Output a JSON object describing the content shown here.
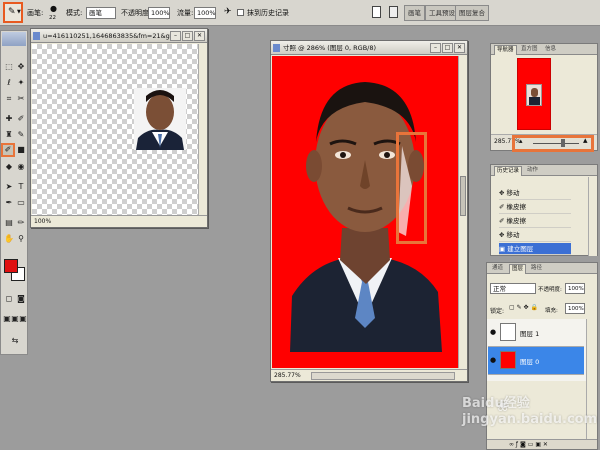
{
  "options_bar": {
    "brush_label": "画笔:",
    "brush_size": "22",
    "mode_label": "模式:",
    "mode_value": "画笔",
    "opacity_label": "不透明度:",
    "opacity_value": "100%",
    "flow_label": "流量:",
    "flow_value": "100%",
    "erase_history_label": "抹到历史记录",
    "tabs": [
      "画笔",
      "工具预设",
      "图层复合"
    ]
  },
  "small_window": {
    "title": "u=416110251,1646863835&fm=21&g...",
    "zoom": "100%"
  },
  "main_window": {
    "title": "寸照 @ 286% (图层 0, RGB/8)",
    "zoom": "285.77%"
  },
  "navigator": {
    "tabs": [
      "导航器",
      "直方图",
      "信息"
    ],
    "zoom": "285.77%"
  },
  "history": {
    "tabs": [
      "历史记录",
      "动作"
    ],
    "items": [
      "移动",
      "橡皮擦",
      "橡皮擦",
      "移动",
      "建立图层"
    ],
    "selected_index": 4
  },
  "layers": {
    "tabs": [
      "通道",
      "图层",
      "路径"
    ],
    "blend_mode": "正常",
    "opacity_label": "不透明度:",
    "opacity_value": "100%",
    "lock_label": "锁定:",
    "fill_label": "填充:",
    "fill_value": "100%",
    "items": [
      {
        "name": "图层 1",
        "selected": false
      },
      {
        "name": "图层 0",
        "selected": true
      }
    ]
  },
  "colors": {
    "foreground": "#e01010",
    "background": "#ffffff",
    "canvas_bg": "#ff0000",
    "annotation": "#e8743a",
    "selection": "#3b6fd4"
  },
  "watermark": "Baidu经验\njingyan.baidu.com"
}
